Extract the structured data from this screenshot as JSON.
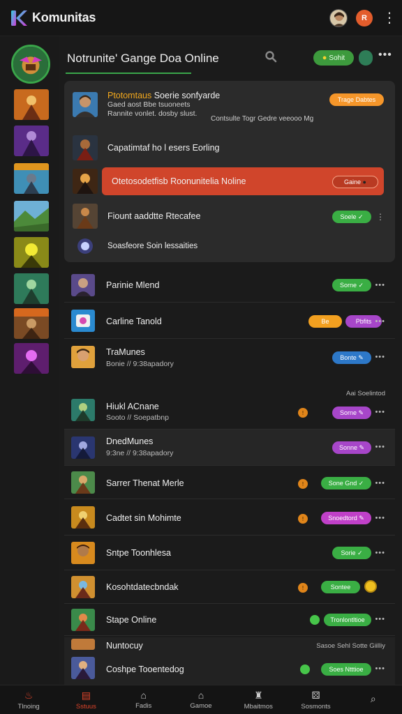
{
  "app": {
    "title": "Komunitas",
    "notif_letter": "R",
    "more": "⋮"
  },
  "header": {
    "title": "Notrunite' Gange Doa Online",
    "status_label": "Sohit",
    "more": "•••"
  },
  "panel": {
    "rows": [
      {
        "prefix": "Ptotomtaus",
        "title": "Soerie sonfyarde",
        "sub1": "Gaed aost Bbe tsuoneets",
        "sub2": "Rannite vonlet. dosby slust.",
        "side_note": "Contsulte Togr Gedre veeooo Mg"
      },
      {
        "title": "Capatimtaf ho l esers Eorling"
      },
      {
        "title": "Otetosodetfisb Roonunitelia Noline"
      },
      {
        "title": "Fiount aaddtte Rtecafee"
      },
      {
        "title": "Soasfeore Soin lessaities"
      }
    ],
    "badges": {
      "tags": "Trage Dabtes",
      "red": "Gaine",
      "green1": "Soele",
      "check": "✓"
    }
  },
  "list": {
    "section_label": "Aai Soelintod",
    "rows": [
      {
        "name": "Parinie Mlend",
        "pill": "Sorne"
      },
      {
        "name": "Carline Tanold",
        "pill_a": "Be",
        "pill_b": "Pbfits"
      },
      {
        "name": "TraMunes",
        "sub": "Bonie // 9:38apadory",
        "pill": "Bonte"
      },
      {
        "name": "Hiukl ACnane",
        "sub": "Sooto // Soepatbnp",
        "pill": "Sorne"
      },
      {
        "name": "DnedMunes",
        "sub": "9:3ne // 9:38apadory",
        "pill": "Sonne"
      },
      {
        "name": "Sarrer Thenat Merle",
        "pill": "Sone Gnd"
      },
      {
        "name": "Cadtet sin Mohimte",
        "pill": "Snoedtord"
      },
      {
        "name": "Sntpe Toonhlesa",
        "pill": "Sorie"
      },
      {
        "name": "Kosohtdatecbndak",
        "pill": "Sontee"
      },
      {
        "name": "Stape Online",
        "pill": "Tronlontltioe"
      },
      {
        "name": "Nuntocuy",
        "meta": "Sasoe Sehl Sotte Giilliy"
      },
      {
        "name": "Coshpe Tooentedog",
        "pill": "Soes Ntttioe"
      }
    ],
    "more": "•••",
    "chevrons": "⌄⌄⌄"
  },
  "bottom_nav": [
    {
      "label": "Tlnoing",
      "icon": "flame-icon"
    },
    {
      "label": "Sstuus",
      "icon": "calendar-icon"
    },
    {
      "label": "Fadis",
      "icon": "home-icon"
    },
    {
      "label": "Gamoe",
      "icon": "home-outline-icon"
    },
    {
      "label": "Mbaitmos",
      "icon": "controller-icon"
    },
    {
      "label": "Sosmonts",
      "icon": "dice-icon"
    },
    {
      "label": "",
      "icon": "search-icon"
    }
  ],
  "colors": {
    "accent_green": "#3aae44",
    "accent_red": "#e0442a",
    "bg": "#1b1b1b"
  }
}
